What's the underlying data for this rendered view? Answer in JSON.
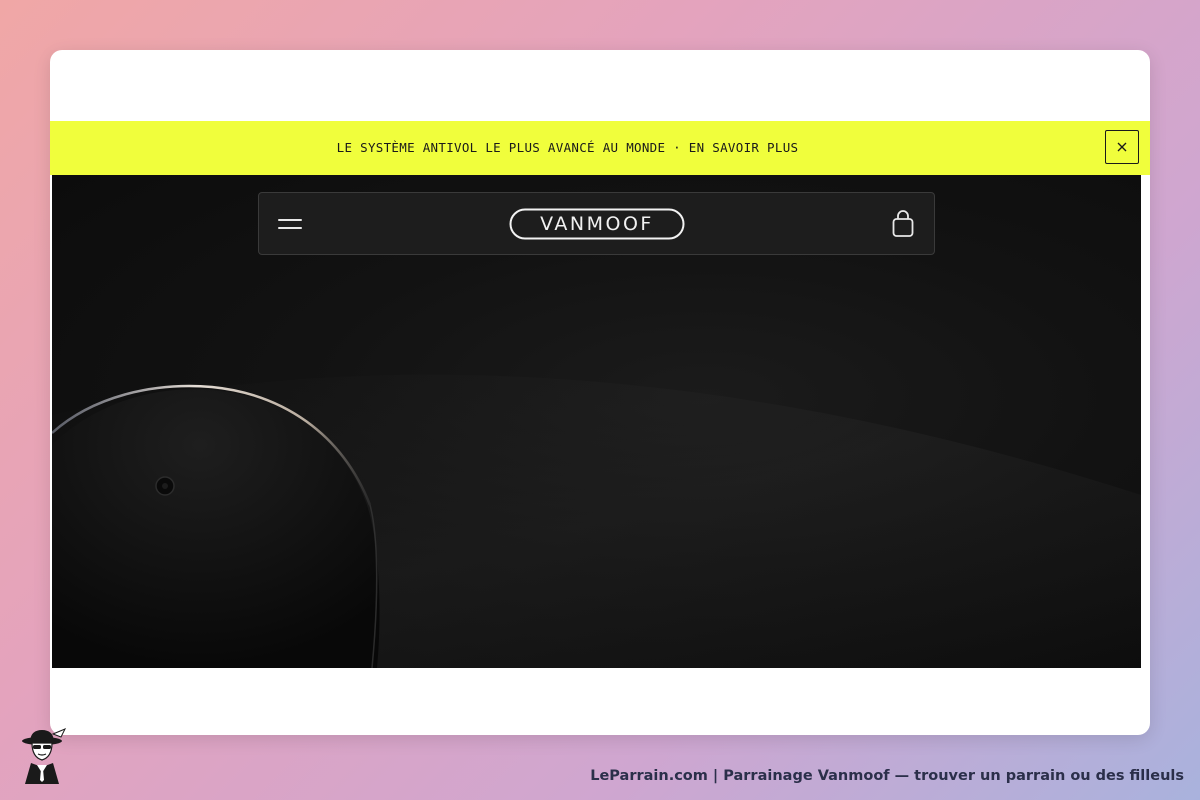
{
  "banner": {
    "text": "LE SYSTÈME ANTIVOL LE PLUS AVANCÉ AU MONDE · EN SAVOIR PLUS",
    "close_icon": "close-icon",
    "background_color": "#f0fe3c"
  },
  "navbar": {
    "menu_icon": "hamburger-menu-icon",
    "logo_text": "VANMOOF",
    "cart_icon": "shopping-bag-icon"
  },
  "hero": {
    "image": "dark-lamp-product-image",
    "background_color": "#111111"
  },
  "footer": {
    "avatar_icon": "mascot-spy-icon",
    "caption": "LeParrain.com | Parrainage Vanmoof — trouver un parrain ou des filleuls"
  }
}
